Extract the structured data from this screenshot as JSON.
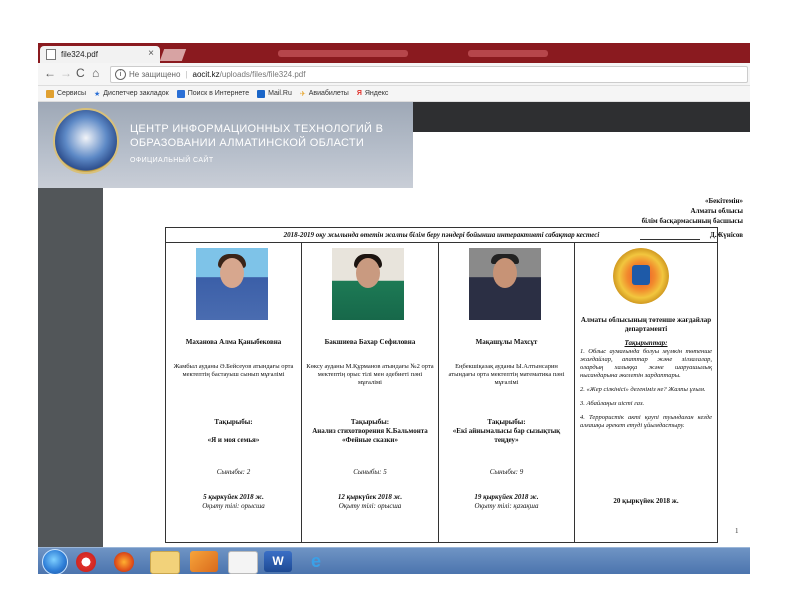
{
  "browser": {
    "tab_title": "file324.pdf",
    "tab_close": "×",
    "nav": {
      "back": "←",
      "forward": "→",
      "reload": "C",
      "home": "⌂"
    },
    "security_text": "Не защищено",
    "url_domain": "aocit.kz",
    "url_path": "/uploads/files/file324.pdf",
    "bookmarks": [
      {
        "label": "Сервисы",
        "icon": "apps-icon",
        "color": "#e0a030"
      },
      {
        "label": "Диспетчер закладок",
        "icon": "star-icon",
        "color": "#2a6fd6"
      },
      {
        "label": "Поиск в Интернете",
        "icon": "search-icon",
        "color": "#2a6fd6"
      },
      {
        "label": "Mail.Ru",
        "icon": "mail-icon",
        "color": "#1a66c8"
      },
      {
        "label": "Авиабилеты",
        "icon": "plane-icon",
        "color": "#e6a020"
      },
      {
        "label": "Яндекс",
        "icon": "yandex-icon",
        "color": "#e0302a"
      }
    ]
  },
  "banner": {
    "title": "ЦЕНТР ИНФОРМАЦИОННЫХ ТЕХНОЛОГИЙ В ОБРАЗОВАНИИ АЛМАТИНСКОЙ ОБЛАСТИ",
    "subtitle": "ОФИЦИАЛЬНЫЙ САЙТ"
  },
  "approval": {
    "line1": "«Бекітемін»",
    "line2": "Алматы облысы",
    "line3": "білім басқармасының басшысы",
    "signatory": "Д.Жүнісов"
  },
  "schedule": {
    "caption": "2018-2019 оқу жылында өтетін жалпы білім беру пәндері бойынша интерактивті сабақтар кестесі",
    "columns": [
      {
        "name": "Маханова Алма Қаныбековна",
        "desc": "Жамбыл ауданы Ә.Бейсеуов атындағы орта мектептің бастауыш сынып мұғалімі",
        "topic_label": "Тақырыбы:",
        "topic": "«Я и моя семья»",
        "grade": "Сыныбы: 2",
        "date": "5 қыркүйек 2018 ж.",
        "lang": "Оқыту тілі: орысша"
      },
      {
        "name": "Бакшиева Бахар Сефиловна",
        "desc": "Көксу ауданы М.Құрманов атындағы №2 орта мектептің орыс тілі мен әдебиеті пәні мұғалімі",
        "topic_label": "Тақырыбы:",
        "topic": "Анализ стихотворения К.Бальмонта «Фейные сказки»",
        "grade": "Сыныбы: 5",
        "date": "12 қыркүйек 2018 ж.",
        "lang": "Оқыту тілі: орысша"
      },
      {
        "name": "Мақашұлы Махсұт",
        "desc": "Еңбекшіқазақ ауданы Ы.Алтынсарин атындағы орта мектептің математика пәні мұғалімі",
        "topic_label": "Тақырыбы:",
        "topic": "«Екі айнымалысы бар сызықтық теңдеу»",
        "grade": "Сыныбы: 9",
        "date": "19 қыркүйек 2018 ж.",
        "lang": "Оқыту тілі: қазақша"
      }
    ],
    "dept": {
      "name": "Алматы облысының төтенше жағдайлар департаменті",
      "tasks_label": "Тақырыптар:",
      "tasks": [
        "1. Облыс аумағында болуы мүмкін төтенше жағдайлар, апаттар және зілзалалар, олардың халыққа және шаруашылық нысандарына әкелетін зардаптары.",
        "2. «Жер сілкінісі» дегеніміз не? Жалпы ұғым.",
        "3. Абайлаңыз иісті газ.",
        "4. Террористік акті қаупі туындаған кезде алғашқы әрекет етуді ұйымдастыру."
      ],
      "date": "20 қыркүйек 2018 ж."
    },
    "page_number": "1"
  }
}
